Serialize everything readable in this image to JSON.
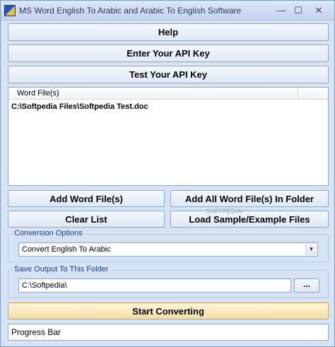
{
  "window": {
    "title": "MS Word English To Arabic and Arabic To English Software",
    "min_symbol": "—",
    "max_symbol": "☐",
    "close_symbol": "✕"
  },
  "buttons": {
    "help": "Help",
    "enter_api_key": "Enter Your API Key",
    "test_api_key": "Test Your API Key",
    "add_word_files": "Add Word File(s)",
    "add_all_in_folder": "Add All Word File(s) In Folder",
    "clear_list": "Clear List",
    "load_samples": "Load Sample/Example Files",
    "browse": "...",
    "start_converting": "Start Converting"
  },
  "file_list": {
    "header": "Word File(s)",
    "items": [
      "C:\\Softpedia Files\\Softpedia Test.doc"
    ]
  },
  "conversion": {
    "label": "Conversion Options",
    "selected": "Convert English To Arabic"
  },
  "output": {
    "label": "Save Output To This Folder",
    "folder": "C:\\Softpedia\\"
  },
  "progress": {
    "text": "Progress Bar"
  },
  "watermark": "SOFTPEDIA"
}
